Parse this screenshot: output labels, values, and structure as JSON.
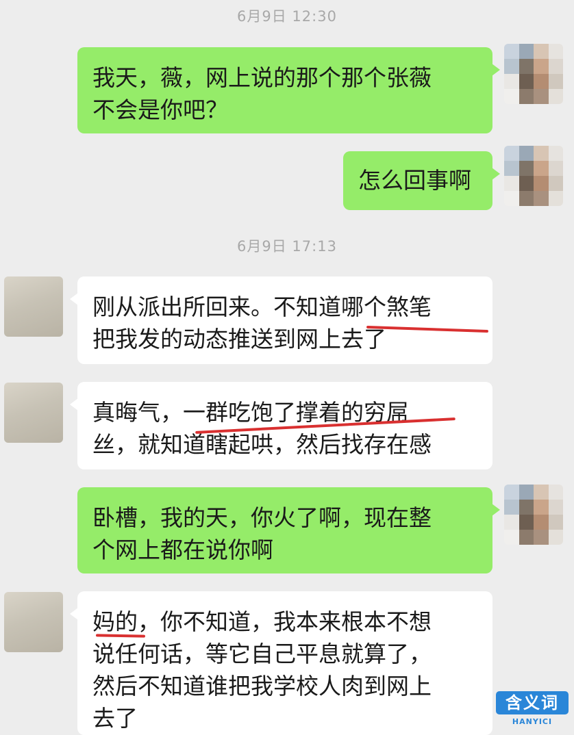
{
  "timestamps": [
    "6月9日 12:30",
    "6月9日 17:13"
  ],
  "messages": [
    {
      "side": "out",
      "lines": [
        "我天，薇，网上说的那个那个张薇",
        "不会是你吧？"
      ]
    },
    {
      "side": "out",
      "lines": [
        "怎么回事啊"
      ]
    },
    {
      "side": "in",
      "lines": [
        "刚从派出所回来。不知道哪个煞笔",
        "把我发的动态推送到网上去了"
      ]
    },
    {
      "side": "in",
      "lines": [
        "真晦气，一群吃饱了撑着的穷屌",
        "丝，就知道瞎起哄，然后找存在感"
      ]
    },
    {
      "side": "out",
      "lines": [
        "卧槽，我的天，你火了啊，现在整",
        "个网上都在说你啊"
      ]
    },
    {
      "side": "in",
      "lines": [
        "妈的，你不知道，我本来根本不想",
        "说任何话，等它自己平息就算了，",
        "然后不知道谁把我学校人肉到网上",
        "去了"
      ]
    }
  ],
  "watermark": {
    "logo": "含义词",
    "sub": "HANYICI"
  },
  "colors": {
    "outgoing": "#95ec69",
    "incoming": "#ffffff",
    "background": "#ededed",
    "underline": "#d93030"
  }
}
